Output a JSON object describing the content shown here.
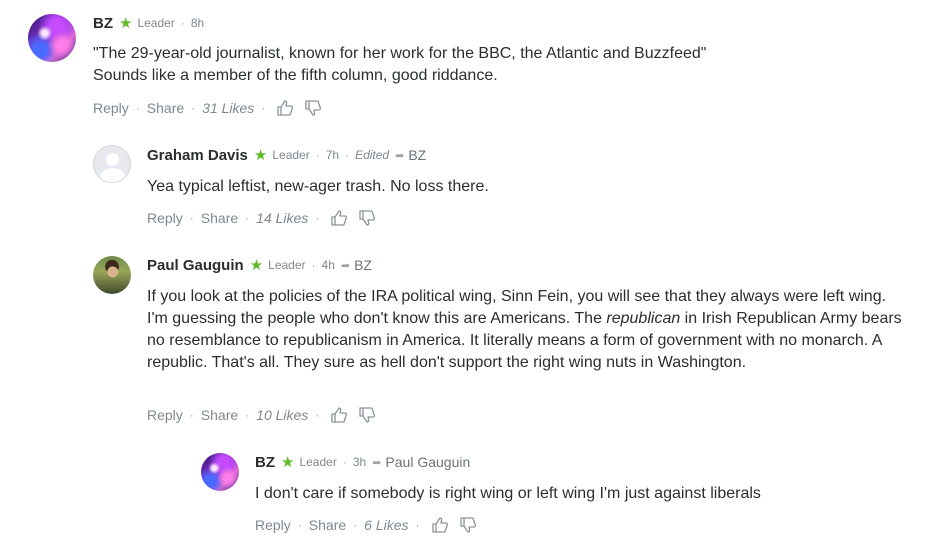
{
  "comments": [
    {
      "author": "BZ",
      "badge": "Leader",
      "time": "8h",
      "edited": "",
      "reply_to": "",
      "lines": [
        "\"The 29-year-old journalist, known for her work for the BBC, the Atlantic and Buzzfeed\"",
        "Sounds like a member of the fifth column, good riddance."
      ],
      "reply_label": "Reply",
      "share_label": "Share",
      "likes": "31 Likes"
    },
    {
      "author": "Graham Davis",
      "badge": "Leader",
      "time": "7h",
      "edited": "Edited",
      "reply_to": "BZ",
      "lines": [
        "Yea typical leftist, new-ager trash. No loss there."
      ],
      "reply_label": "Reply",
      "share_label": "Share",
      "likes": "14 Likes"
    },
    {
      "author": "Paul Gauguin",
      "badge": "Leader",
      "time": "4h",
      "edited": "",
      "reply_to": "BZ",
      "text_parts": {
        "before": "If you look at the policies of the IRA political wing, Sinn Fein, you will see that they always were left wing. I'm guessing the people who don't know this are Americans. The ",
        "italic": "republican",
        "after": " in Irish Republican Army bears no resemblance to republicanism in America. It literally means a form of government with no monarch. A republic. That's all. They sure as hell don't support the right wing nuts in Washington."
      },
      "reply_label": "Reply",
      "share_label": "Share",
      "likes": "10 Likes"
    },
    {
      "author": "BZ",
      "badge": "Leader",
      "time": "3h",
      "edited": "",
      "reply_to": "Paul Gauguin",
      "lines": [
        "I don't care if somebody is right wing or left wing I'm just against liberals"
      ],
      "reply_label": "Reply",
      "share_label": "Share",
      "likes": "6 Likes"
    }
  ],
  "symbols": {
    "star": "★",
    "dot": "·",
    "reply_arrow": "➦"
  },
  "colors": {
    "leader_star": "#5fbb2a",
    "text": "#2a2e2e",
    "meta": "#7e8890"
  },
  "icons": [
    "star-icon",
    "reply-arrow-icon",
    "thumbs-up-icon",
    "thumbs-down-icon"
  ]
}
